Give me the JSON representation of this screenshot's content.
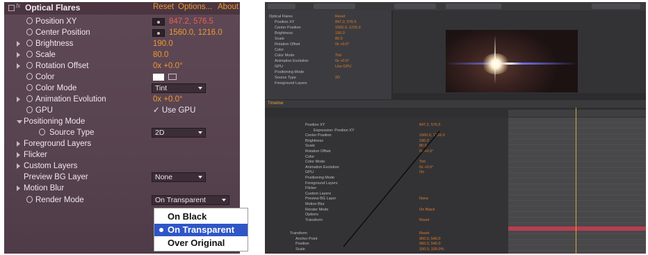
{
  "left_panel": {
    "effect_name": "Optical Flares",
    "header_links": [
      "Reset",
      "Options...",
      "About"
    ],
    "properties": [
      {
        "label": "Position XY",
        "value": "847.2, 576.5",
        "type": "position"
      },
      {
        "label": "Center Position",
        "value": "1560.0, 1216.0",
        "type": "position"
      },
      {
        "label": "Brightness",
        "value": "190.0"
      },
      {
        "label": "Scale",
        "value": "80.0"
      },
      {
        "label": "Rotation Offset",
        "value": "0x +0.0°"
      },
      {
        "label": "Color",
        "type": "color",
        "color": "#ffffff"
      },
      {
        "label": "Color Mode",
        "value": "Tint",
        "type": "dropdown"
      },
      {
        "label": "Animation Evolution",
        "value": "0x +0.0°"
      },
      {
        "label": "GPU",
        "value": "✓ Use GPU",
        "type": "checkbox"
      },
      {
        "label": "Positioning Mode",
        "type": "group"
      },
      {
        "label": "Source Type",
        "value": "2D",
        "type": "dropdown"
      },
      {
        "label": "Foreground Layers",
        "type": "group"
      },
      {
        "label": "Flicker",
        "type": "group"
      },
      {
        "label": "Custom Layers",
        "type": "group"
      },
      {
        "label": "Preview BG Layer",
        "value": "None",
        "type": "dropdown"
      },
      {
        "label": "Motion Blur",
        "type": "group"
      },
      {
        "label": "Render Mode",
        "value": "On Transparent",
        "type": "dropdown"
      }
    ],
    "render_mode_popup": {
      "options": [
        "On Black",
        "On Transparent",
        "Over Original"
      ],
      "selected": "On Transparent"
    },
    "colors": {
      "value_orange": "#ee9a2d",
      "value_red": "#f05c4a",
      "panel_bg": "#57424f",
      "popup_highlight": "#2f56c7"
    }
  },
  "right_panel": {
    "timeline_tab": "Timeline",
    "effect_controls_lines": [
      "Optical Flares",
      "Position XY",
      "Center Position",
      "Brightness",
      "Scale",
      "Rotation Offset",
      "Color",
      "Color Mode",
      "Animation Evolution",
      "GPU",
      "Positioning Mode",
      "Source Type",
      "Foreground Layers"
    ],
    "effect_controls_values": [
      "Reset",
      "847.2, 576.5",
      "1560.0, 1216.0",
      "190.0",
      "80.0",
      "0x +0.0°",
      "",
      "Tint",
      "0x +0.0°",
      "Use GPU",
      "",
      "2D",
      ""
    ],
    "layer_lines": [
      "Position XY",
      "Expression: Position XY",
      "Center Position",
      "Brightness",
      "Scale",
      "Rotation Offset",
      "Color",
      "Color Mode",
      "Animation Evolution",
      "GPU",
      "Positioning Mode",
      "Foreground Layers",
      "Flicker",
      "Custom Layers",
      "Preview BG Layer",
      "Motion Blur",
      "Render Mode",
      "Options",
      "Transform"
    ],
    "layer_values": [
      "847.2, 576.5",
      "",
      "1560.0, 1216.0",
      "190.0",
      "80.0",
      "0x +0.0°",
      "",
      "Tint",
      "0x +0.0°",
      "On",
      "",
      "",
      "",
      "",
      "None",
      "",
      "On Black",
      "",
      "Reset"
    ],
    "transform_lines": [
      "Transform",
      "Anchor Point",
      "Position",
      "Scale"
    ],
    "transform_values": [
      "Reset",
      "960.0, 540.0",
      "960.0, 540.0",
      "100.0, 100.0%"
    ],
    "colors": {
      "layer_bar": "#b83e4e",
      "time_indicator": "#d9a23a",
      "value_orange": "#e07b2a"
    }
  }
}
